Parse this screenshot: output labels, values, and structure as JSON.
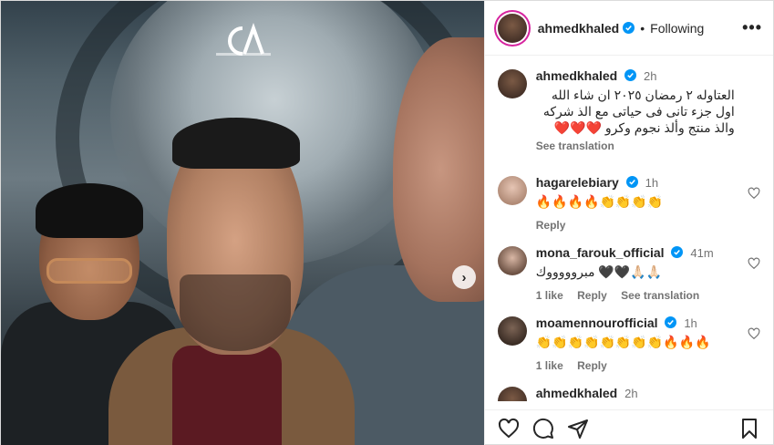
{
  "post": {
    "username": "ahmedkhaled",
    "follow_status": "Following",
    "more_glyph": "•••",
    "dot": "•"
  },
  "caption": {
    "username": "ahmedkhaled",
    "time": "2h",
    "text": "العتاوله ٢ رمضان ٢٠٢٥ ان شاء الله اول جزء تانى فى حياتى مع الذ شركه والذ منتج وألذ نجوم وكرو ❤️❤️❤️",
    "see_translation": "See translation"
  },
  "comments": [
    {
      "username": "hagarelebiary",
      "time": "1h",
      "text": "🔥🔥🔥🔥👏👏👏👏",
      "likes": "",
      "reply": "Reply",
      "see_translation": ""
    },
    {
      "username": "mona_farouk_official",
      "time": "41m",
      "text": "مبروووووك 🖤🖤🙏🏻🙏🏻",
      "likes": "1 like",
      "reply": "Reply",
      "see_translation": "See translation"
    },
    {
      "username": "moamennourofficial",
      "time": "1h",
      "text": "👏👏👏👏👏👏👏👏🔥🔥🔥",
      "likes": "1 like",
      "reply": "Reply",
      "see_translation": ""
    },
    {
      "username": "ahmedkhaled",
      "time": "2h",
      "text": "",
      "likes": "",
      "reply": "",
      "see_translation": ""
    }
  ],
  "media": {
    "logo_text": "CA",
    "next_glyph": "›"
  },
  "icons": {
    "like": "heart-icon",
    "comment": "comment-icon",
    "share": "share-icon",
    "save": "bookmark-icon",
    "verified": "verified-badge-icon"
  },
  "colors": {
    "verified": "#0095f6",
    "story_ring": "#d6249f"
  }
}
